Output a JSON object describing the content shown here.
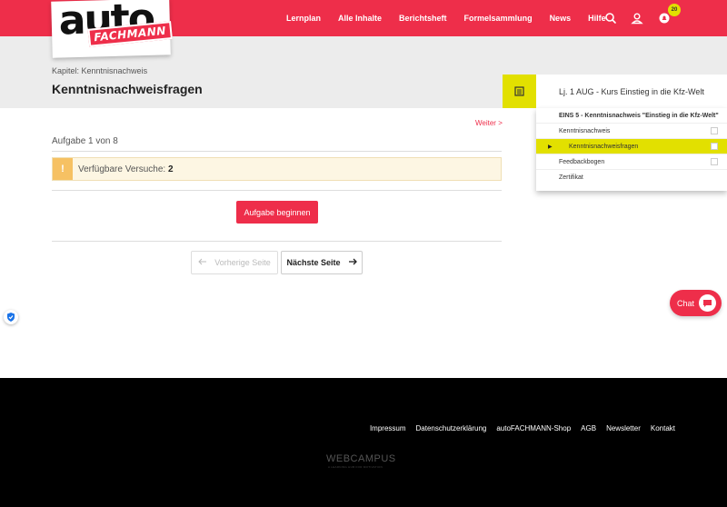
{
  "brand": {
    "logo_main": "auto",
    "logo_sub": "FACHMANN"
  },
  "nav": {
    "items": [
      "Lernplan",
      "Alle Inhalte",
      "Berichtsheft",
      "Formelsammlung",
      "News",
      "Hilfe"
    ],
    "notification_count": "20",
    "icons": [
      "search-icon",
      "user-icon",
      "notification-icon"
    ]
  },
  "header": {
    "breadcrumb": "Kapitel: Kenntnisnachweis",
    "title": "Kenntnisnachweisfragen"
  },
  "main": {
    "next_link": "Weiter >",
    "task_counter": "Aufgabe 1 von 8",
    "attempts_label": "Verfügbare Versuche:",
    "attempts_value": "2",
    "alert_icon": "!",
    "start_button": "Aufgabe beginnen",
    "prev_page": "Vorherige Seite",
    "next_page": "Nächste Seite"
  },
  "course_panel": {
    "title": "Lj. 1 AUG - Kurs Einstieg in die Kfz-Welt",
    "section": "EINS 5 - Kenntnisnachweis \"Einstieg in die Kfz-Welt\"",
    "items": [
      "Kenntnisnachweis",
      "Kenntnisnachweisfragen",
      "Feedbackbogen",
      "Zertifikat"
    ],
    "active_index": 1
  },
  "chat": {
    "label": "Chat"
  },
  "footer": {
    "links": [
      "Impressum",
      "Datenschutzerklärung",
      "autoFACHMANN-Shop",
      "AGB",
      "Newsletter",
      "Kontakt"
    ],
    "brand": "WEBCAMPUS",
    "brand_sub": "A LEARNING HUB FOR MOTIVATION"
  },
  "colors": {
    "accent": "#ee2e4a",
    "highlight": "#e2e000",
    "band": "#ececec",
    "alert_bg": "#fdf6e3",
    "alert_icon": "#f6c163"
  }
}
